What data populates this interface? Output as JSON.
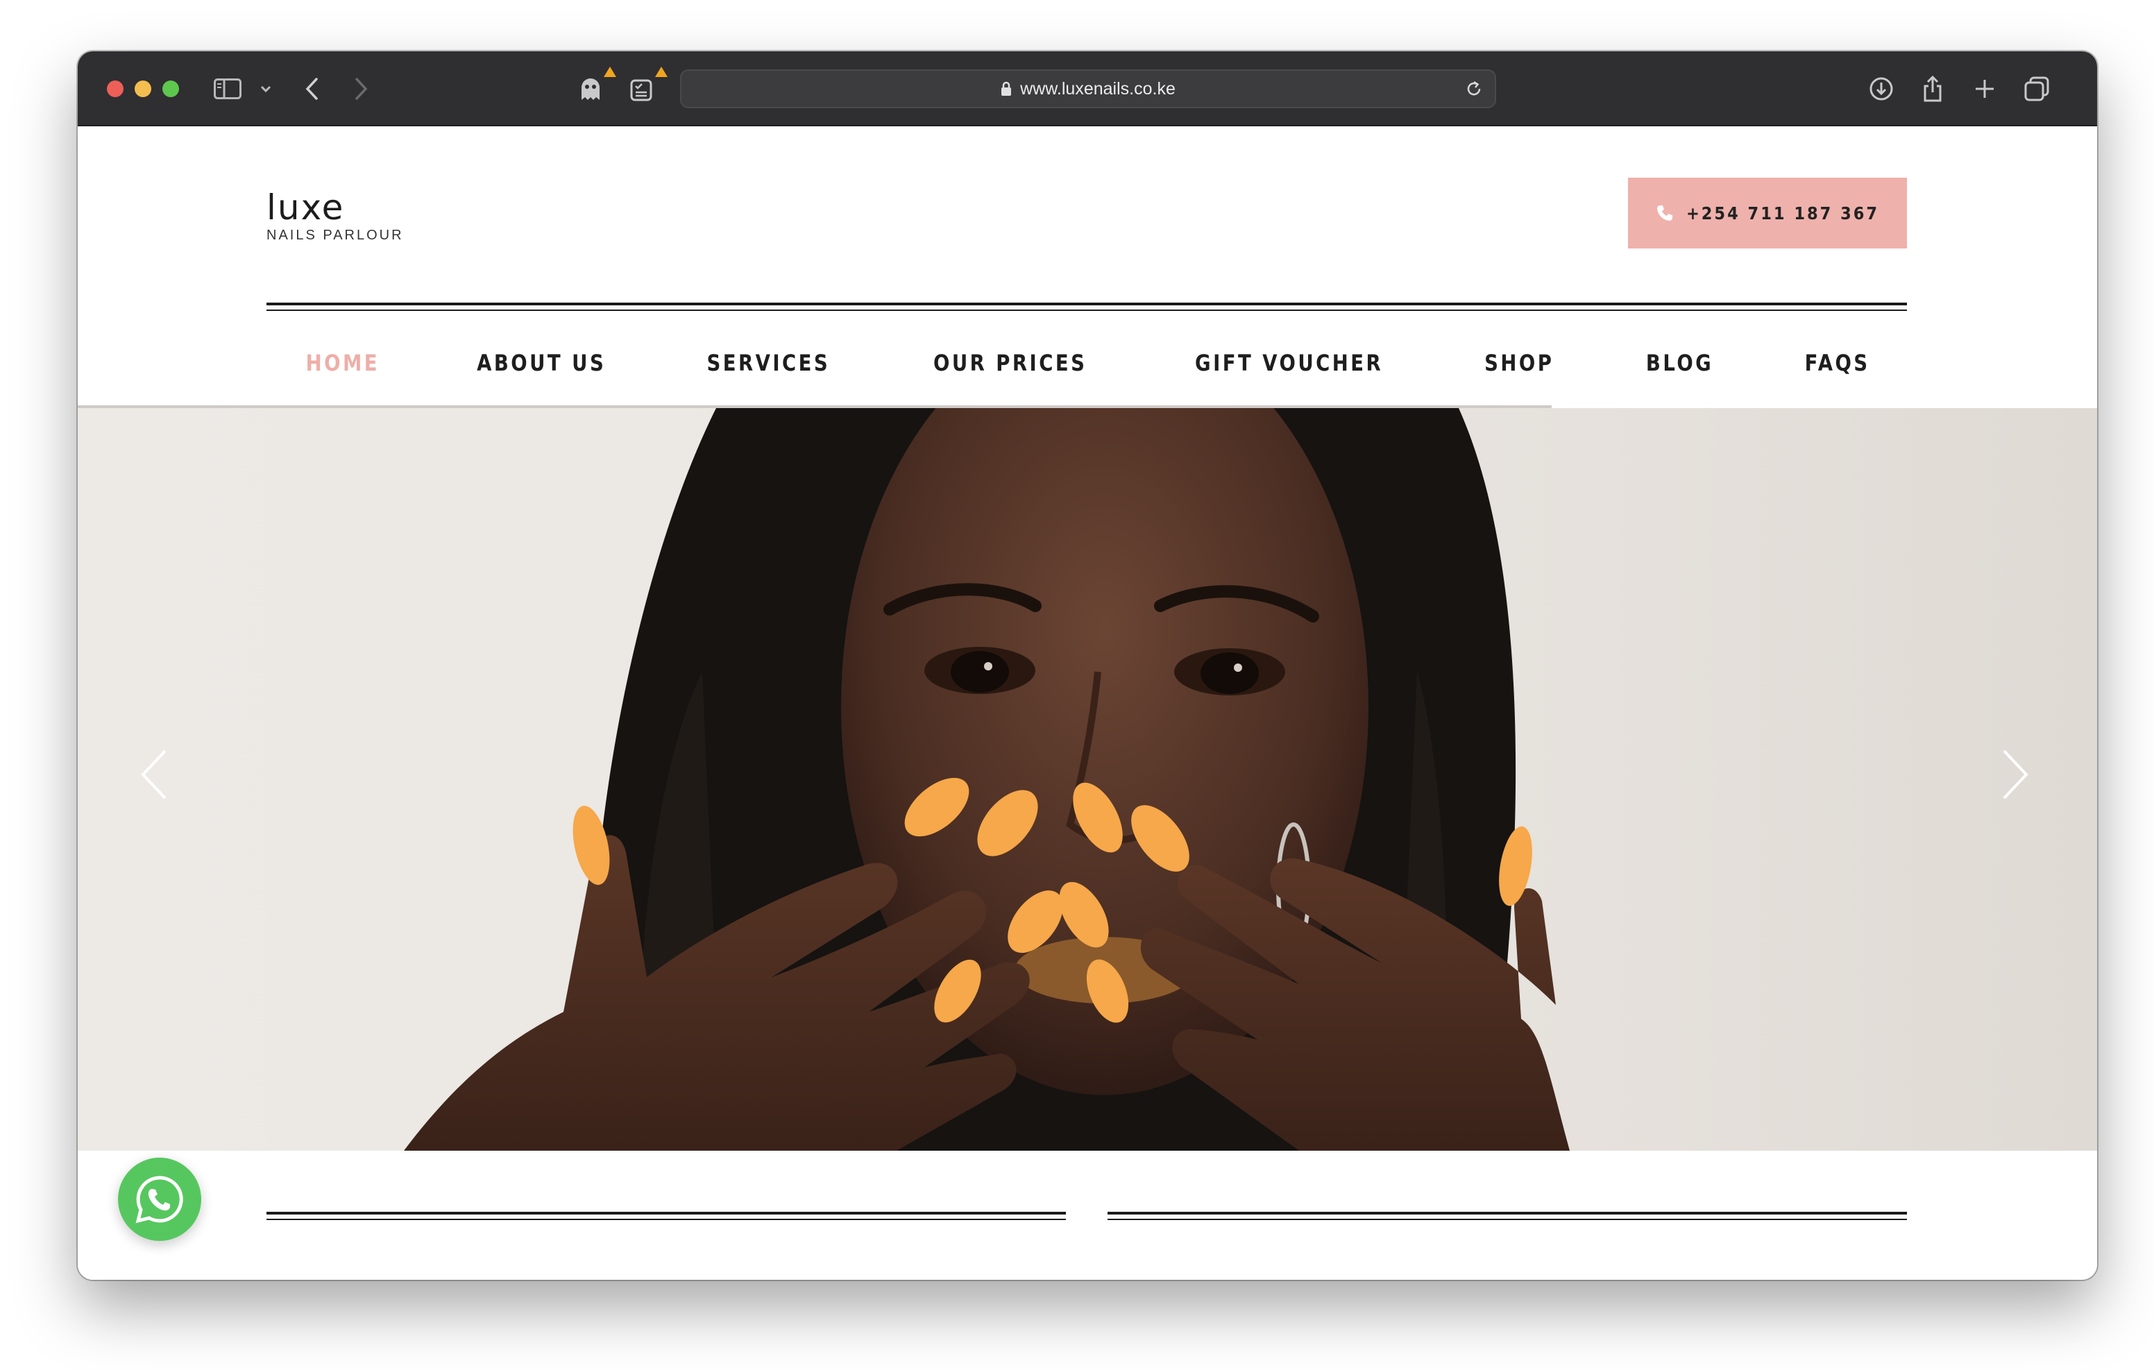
{
  "browser": {
    "url": "www.luxenails.co.ke",
    "icons": [
      "sidebar-icon",
      "chevron-down-icon",
      "back-icon",
      "forward-icon",
      "ghost-extension-icon",
      "checklist-extension-icon",
      "lock-icon",
      "reload-icon",
      "download-icon",
      "share-icon",
      "new-tab-icon",
      "tabs-overview-icon"
    ]
  },
  "header": {
    "logo_word": "luxe",
    "logo_sub": "NAILS PARLOUR",
    "phone": "+254 711 187 367"
  },
  "nav": {
    "items": [
      "HOME",
      "ABOUT US",
      "SERVICES",
      "OUR PRICES",
      "GIFT VOUCHER",
      "SHOP",
      "BLOG",
      "FAQS"
    ],
    "active": "HOME"
  },
  "hero": {
    "slide_progress": 0.73,
    "controls": [
      "chevron-left-icon",
      "chevron-right-icon"
    ]
  },
  "colors": {
    "accent_pink": "#efb1ab",
    "nav_active": "#efaea8",
    "whatsapp_green": "#56c75f",
    "nail_orange": "#f6a84a"
  }
}
